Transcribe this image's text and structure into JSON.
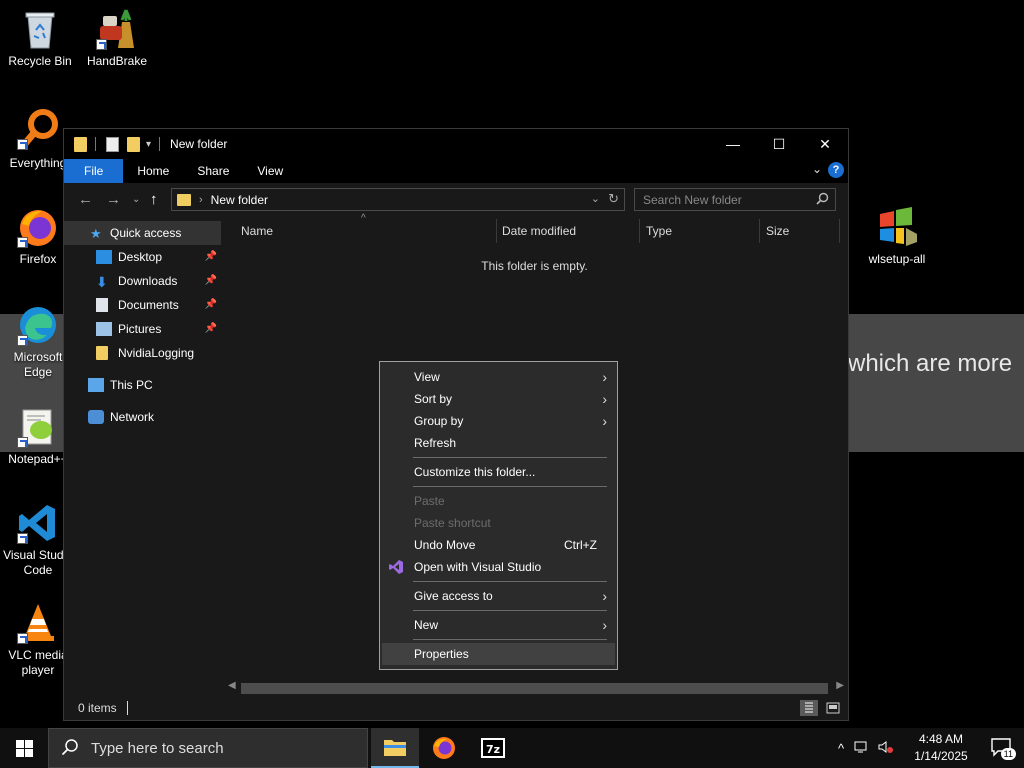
{
  "desktop": {
    "icons": [
      {
        "label": "Recycle Bin"
      },
      {
        "label": "HandBrake"
      },
      {
        "label": "Everything"
      },
      {
        "label": "Firefox"
      },
      {
        "label": "Microsoft Edge"
      },
      {
        "label": "Notepad++"
      },
      {
        "label": "Visual Studio Code"
      },
      {
        "label": "VLC media player"
      },
      {
        "label": "wlsetup-all"
      }
    ],
    "bg_text": "which are more"
  },
  "window": {
    "title": "New folder",
    "ribbon_tabs": [
      "File",
      "Home",
      "Share",
      "View"
    ],
    "help": "?",
    "address_path": "New folder",
    "search_placeholder": "Search New folder",
    "nav": {
      "quick_access": "Quick access",
      "items": [
        "Desktop",
        "Downloads",
        "Documents",
        "Pictures",
        "NvidiaLogging"
      ],
      "this_pc": "This PC",
      "network": "Network"
    },
    "columns": [
      "Name",
      "Date modified",
      "Type",
      "Size"
    ],
    "empty_message": "This folder is empty.",
    "status_count": "0 items"
  },
  "context_menu": {
    "view": "View",
    "sort_by": "Sort by",
    "group_by": "Group by",
    "refresh": "Refresh",
    "customize": "Customize this folder...",
    "paste": "Paste",
    "paste_shortcut": "Paste shortcut",
    "undo_move": "Undo Move",
    "undo_shortcut": "Ctrl+Z",
    "open_vs": "Open with Visual Studio",
    "give_access": "Give access to",
    "new": "New",
    "properties": "Properties"
  },
  "taskbar": {
    "search_placeholder": "Type here to search",
    "time": "4:48 AM",
    "date": "1/14/2025",
    "notification_count": "11"
  },
  "colors": {
    "accent": "#1a6dd1",
    "folder": "#f2ce62",
    "window_bg": "#191919",
    "menu_bg": "#2b2b2b"
  }
}
